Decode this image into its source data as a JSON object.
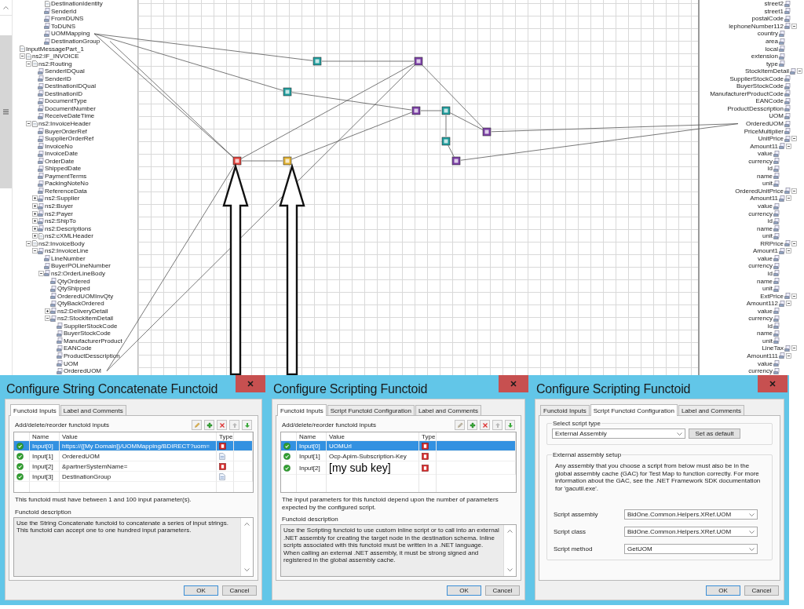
{
  "source_tree": {
    "clipped_items": [
      {
        "label": "DestinationIdentity",
        "kind": "record"
      },
      {
        "label": "SenderId",
        "kind": "field"
      },
      {
        "label": "FromDUNS",
        "kind": "field"
      },
      {
        "label": "ToDUNS",
        "kind": "field"
      },
      {
        "label": "UOMMapping",
        "kind": "field"
      },
      {
        "label": "DestinationGroup",
        "kind": "field"
      }
    ],
    "nodes": [
      {
        "label": "InputMessagePart_1",
        "kind": "record",
        "children": [
          {
            "label": "ns2:IF_INVOICE",
            "kind": "record",
            "expanded": true,
            "children": [
              {
                "label": "ns2:Routing",
                "kind": "record",
                "expanded": true,
                "children": [
                  {
                    "label": "SenderIDQual",
                    "kind": "field"
                  },
                  {
                    "label": "SenderID",
                    "kind": "field"
                  },
                  {
                    "label": "DestinationIDQual",
                    "kind": "field"
                  },
                  {
                    "label": "DestinationID",
                    "kind": "field"
                  },
                  {
                    "label": "DocumentType",
                    "kind": "field"
                  },
                  {
                    "label": "DocumentNumber",
                    "kind": "field"
                  },
                  {
                    "label": "ReceiveDateTime",
                    "kind": "field"
                  }
                ]
              },
              {
                "label": "ns2:InvoiceHeader",
                "kind": "record",
                "expanded": true,
                "children": [
                  {
                    "label": "BuyerOrderRef",
                    "kind": "field"
                  },
                  {
                    "label": "SupplierOrderRef",
                    "kind": "field"
                  },
                  {
                    "label": "InvoiceNo",
                    "kind": "field"
                  },
                  {
                    "label": "InvoiceDate",
                    "kind": "field"
                  },
                  {
                    "label": "OrderDate",
                    "kind": "field"
                  },
                  {
                    "label": "ShippedDate",
                    "kind": "field"
                  },
                  {
                    "label": "PaymentTerms",
                    "kind": "field"
                  },
                  {
                    "label": "PackingNoteNo",
                    "kind": "field"
                  },
                  {
                    "label": "ReferenceData",
                    "kind": "field"
                  },
                  {
                    "label": "ns2:Supplier",
                    "kind": "field",
                    "expanded": false
                  },
                  {
                    "label": "ns2:Buyer",
                    "kind": "field",
                    "expanded": false
                  },
                  {
                    "label": "ns2:Payer",
                    "kind": "field",
                    "expanded": false
                  },
                  {
                    "label": "ns2:ShipTo",
                    "kind": "field",
                    "expanded": false
                  },
                  {
                    "label": "ns2:Descriptions",
                    "kind": "field",
                    "expanded": false
                  },
                  {
                    "label": "ns2:cXMLHeader",
                    "kind": "record",
                    "expanded": false
                  }
                ]
              },
              {
                "label": "ns2:InvoiceBody",
                "kind": "record",
                "expanded": true,
                "children": [
                  {
                    "label": "ns2:InvoiceLine",
                    "kind": "field",
                    "expanded": true,
                    "children": [
                      {
                        "label": "LineNumber",
                        "kind": "field"
                      },
                      {
                        "label": "BuyerPOLineNumber",
                        "kind": "field"
                      },
                      {
                        "label": "ns2:OrderLineBody",
                        "kind": "field",
                        "expanded": true,
                        "children": [
                          {
                            "label": "QtyOrdered",
                            "kind": "field"
                          },
                          {
                            "label": "QtyShipped",
                            "kind": "field"
                          },
                          {
                            "label": "OrderedUOMInvQty",
                            "kind": "field"
                          },
                          {
                            "label": "QtyBackOrdered",
                            "kind": "field"
                          },
                          {
                            "label": "ns2:DeliveryDetail",
                            "kind": "field",
                            "expanded": false
                          },
                          {
                            "label": "ns2:StockItemDetail",
                            "kind": "field",
                            "expanded": true,
                            "children": [
                              {
                                "label": "SupplierStockCode",
                                "kind": "field"
                              },
                              {
                                "label": "BuyerStockCode",
                                "kind": "field"
                              },
                              {
                                "label": "ManufacturerProduct",
                                "kind": "field"
                              },
                              {
                                "label": "EANCode",
                                "kind": "field"
                              },
                              {
                                "label": "ProductDesscription",
                                "kind": "field"
                              },
                              {
                                "label": "UOM",
                                "kind": "field"
                              },
                              {
                                "label": "OrderedUOM",
                                "kind": "field"
                              }
                            ]
                          }
                        ]
                      }
                    ]
                  }
                ]
              }
            ]
          }
        ]
      }
    ]
  },
  "destination_tree": {
    "clipped_items": [
      {
        "label": "street2"
      },
      {
        "label": "street1"
      },
      {
        "label": "postalCode"
      },
      {
        "label": "lephoneNumber112",
        "expanded": true,
        "children": [
          {
            "label": "country"
          },
          {
            "label": "area"
          },
          {
            "label": "local"
          },
          {
            "label": "extension"
          },
          {
            "label": "type"
          }
        ]
      }
    ],
    "nodes": [
      {
        "label": "StockItemDetail",
        "expanded": true,
        "children": [
          {
            "label": "SupplierStockCode"
          },
          {
            "label": "BuyerStockCode"
          },
          {
            "label": "ManufacturerProductCode"
          },
          {
            "label": "EANCode"
          },
          {
            "label": "ProductDesscription"
          },
          {
            "label": "UOM"
          },
          {
            "label": "OrderedUOM"
          },
          {
            "label": "PriceMultiplier"
          },
          {
            "label": "UnitPrice",
            "expanded": true,
            "children": [
              {
                "label": "Amount11",
                "expanded": true,
                "children": [
                  {
                    "label": "value"
                  },
                  {
                    "label": "currency"
                  },
                  {
                    "label": "id"
                  },
                  {
                    "label": "name"
                  },
                  {
                    "label": "unit"
                  }
                ]
              }
            ]
          },
          {
            "label": "OrderedUnitPrice",
            "expanded": true,
            "children": [
              {
                "label": "Amount11",
                "expanded": true,
                "children": [
                  {
                    "label": "value"
                  },
                  {
                    "label": "currency"
                  },
                  {
                    "label": "id"
                  },
                  {
                    "label": "name"
                  },
                  {
                    "label": "unit"
                  }
                ]
              }
            ]
          },
          {
            "label": "RRPrice",
            "expanded": true,
            "children": [
              {
                "label": "Amount1",
                "expanded": true,
                "children": [
                  {
                    "label": "value"
                  },
                  {
                    "label": "currency"
                  },
                  {
                    "label": "id"
                  },
                  {
                    "label": "name"
                  },
                  {
                    "label": "unit"
                  }
                ]
              }
            ]
          },
          {
            "label": "ExtPrice",
            "expanded": true,
            "children": [
              {
                "label": "Amount112",
                "expanded": true,
                "children": [
                  {
                    "label": "value"
                  },
                  {
                    "label": "currency"
                  },
                  {
                    "label": "id"
                  },
                  {
                    "label": "name"
                  },
                  {
                    "label": "unit"
                  }
                ]
              }
            ]
          },
          {
            "label": "LineTax",
            "expanded": true,
            "children": [
              {
                "label": "Amount111",
                "expanded": true,
                "children": [
                  {
                    "label": "value"
                  },
                  {
                    "label": "currency"
                  }
                ]
              }
            ]
          }
        ]
      }
    ]
  },
  "dialogs": [
    {
      "kind": "inputs",
      "title": "Configure String Concatenate Functoid",
      "tabs": [
        {
          "label": "Functoid Inputs",
          "selected": true
        },
        {
          "label": "Label and Comments",
          "selected": false
        }
      ],
      "toolbar_label": "Add/delete/reorder functoid inputs",
      "toolbar": [
        {
          "kind": "edit",
          "disabled": false
        },
        {
          "kind": "add",
          "disabled": false
        },
        {
          "kind": "delete",
          "disabled": false
        },
        {
          "kind": "up",
          "disabled": true
        },
        {
          "kind": "down",
          "disabled": false
        }
      ],
      "columns": [
        "Name",
        "Value",
        "Type"
      ],
      "rows": [
        {
          "name": "Input[0]",
          "value": "https://{[My Domain]}/UOMMapping/BDIRECT?uom=",
          "kind": "constant",
          "selected": true,
          "callout": false
        },
        {
          "name": "Input[1]",
          "value": "OrderedUOM",
          "kind": "link",
          "selected": false,
          "callout": false
        },
        {
          "name": "Input[2]",
          "value": "&partnerSystemName=",
          "kind": "constant",
          "selected": false,
          "callout": false
        },
        {
          "name": "Input[3]",
          "value": "DestinationGroup",
          "kind": "link",
          "selected": false,
          "callout": false
        }
      ],
      "note": "This functoid must have between 1 and 100 input parameter(s).",
      "description_label": "Functoid description",
      "description": "Use the String Concatenate functoid to concatenate a series of input strings. This functoid can accept one to one hundred input parameters.",
      "buttons": [
        "OK",
        "Cancel"
      ]
    },
    {
      "kind": "inputs",
      "title": "Configure Scripting Functoid",
      "tabs": [
        {
          "label": "Functoid Inputs",
          "selected": true
        },
        {
          "label": "Script Functoid Configuration",
          "selected": false
        },
        {
          "label": "Label and Comments",
          "selected": false
        }
      ],
      "toolbar_label": "Add/delete/reorder functoid inputs",
      "toolbar": [
        {
          "kind": "edit",
          "disabled": true
        },
        {
          "kind": "add",
          "disabled": false
        },
        {
          "kind": "delete",
          "disabled": false
        },
        {
          "kind": "up",
          "disabled": true
        },
        {
          "kind": "down",
          "disabled": false
        }
      ],
      "columns": [
        "Name",
        "Value",
        "Type"
      ],
      "rows": [
        {
          "name": "Input[0]",
          "value": "UOMUrl",
          "kind": "constant",
          "selected": true,
          "callout": false
        },
        {
          "name": "Input[1]",
          "value": "Ocp-Apim-Subscription-Key",
          "kind": "constant",
          "selected": false,
          "callout": false
        },
        {
          "name": "Input[2]",
          "value": "[my sub key]",
          "kind": "constant",
          "selected": false,
          "callout": true
        }
      ],
      "note": "The input parameters for this functoid depend upon the number of parameters expected by the configured script.",
      "description_label": "Functoid description",
      "description": "Use the Scripting functoid to use custom inline script or to call into an external .NET assembly for creating the target node in the destination schema. Inline scripts associated with this functoid must be written in a .NET language. When calling an external .NET assembly, it must be strong signed and registered in the global assembly cache.",
      "buttons": [
        "OK",
        "Cancel"
      ]
    },
    {
      "kind": "script_config",
      "title": "Configure Scripting Functoid",
      "tabs": [
        {
          "label": "Functoid Inputs",
          "selected": false
        },
        {
          "label": "Script Functoid Configuration",
          "selected": true
        },
        {
          "label": "Label and Comments",
          "selected": false
        }
      ],
      "script_type": {
        "label": "Select script type",
        "value": "External Assembly",
        "button": "Set as default"
      },
      "assembly_setup": {
        "label": "External assembly setup",
        "text": "Any assembly that you choose a script from below must also be in the global assembly cache (GAC) for Test Map to function correctly. For more information about the GAC, see the .NET Framework SDK documentation for 'gacutil.exe'.",
        "fields": [
          {
            "label": "Script assembly",
            "value": "BidOne.Common.Helpers.XRef.UOM"
          },
          {
            "label": "Script class",
            "value": "BidOne.Common.Helpers.XRef.UOM"
          },
          {
            "label": "Script method",
            "value": "GetUOM"
          }
        ]
      },
      "buttons": [
        "OK",
        "Cancel"
      ]
    }
  ]
}
